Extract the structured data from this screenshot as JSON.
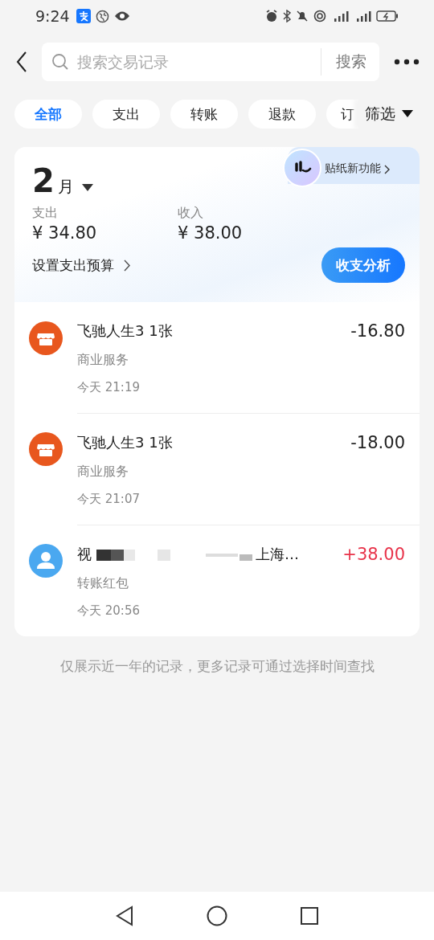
{
  "status_bar": {
    "time": "9:24"
  },
  "search": {
    "placeholder": "搜索交易记录",
    "button": "搜索"
  },
  "tabs": [
    {
      "label": "全部",
      "selected": true
    },
    {
      "label": "支出",
      "selected": false
    },
    {
      "label": "转账",
      "selected": false
    },
    {
      "label": "退款",
      "selected": false
    },
    {
      "label": "订",
      "selected": false
    }
  ],
  "filter": "筛选",
  "sticker_banner": "贴纸新功能",
  "summary": {
    "month_number": "2",
    "month_unit": "月",
    "expense_label": "支出",
    "expense": "¥ 34.80",
    "income_label": "收入",
    "income": "¥ 38.00",
    "budget_link": "设置支出预算",
    "analysis_button": "收支分析"
  },
  "transactions": [
    {
      "kind": "shop",
      "title": "飞驰人生3 1张",
      "redacted": false,
      "category": "商业服务",
      "time": "今天 21:19",
      "amount": "-16.80",
      "color": "#222222"
    },
    {
      "kind": "shop",
      "title": "飞驰人生3 1张",
      "redacted": false,
      "category": "商业服务",
      "time": "今天 21:07",
      "amount": "-18.00",
      "color": "#222222"
    },
    {
      "kind": "person",
      "title": "视",
      "redacted": true,
      "title_end": "上海…",
      "category": "转账红包",
      "time": "今天 20:56",
      "amount": "+38.00",
      "color": "#e8334a"
    }
  ],
  "footer_note": "仅展示近一年的记录，更多记录可通过选择时间查找"
}
